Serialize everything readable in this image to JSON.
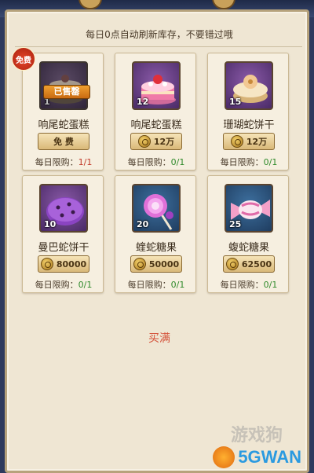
{
  "header": {
    "hint": "每日0点自动刷新库存，不要错过哦"
  },
  "items": [
    {
      "name": "响尾蛇蛋糕",
      "qty": "1",
      "price": "免 费",
      "coin": false,
      "limit_label": "每日限购：",
      "limit_value": "1/1",
      "limit_full": true,
      "sold_label": "已售罄",
      "free_badge": "免费",
      "art": "cake",
      "bg": "gray"
    },
    {
      "name": "响尾蛇蛋糕",
      "qty": "12",
      "price": "12万",
      "coin": true,
      "limit_label": "每日限购：",
      "limit_value": "0/1",
      "limit_full": false,
      "art": "cake",
      "bg": "purple"
    },
    {
      "name": "珊瑚蛇饼干",
      "qty": "15",
      "price": "12万",
      "coin": true,
      "limit_label": "每日限购：",
      "limit_value": "0/1",
      "limit_full": false,
      "art": "cookie",
      "bg": "purple"
    },
    {
      "name": "曼巴蛇饼干",
      "qty": "10",
      "price": "80000",
      "coin": true,
      "limit_label": "每日限购：",
      "limit_value": "0/1",
      "limit_full": false,
      "art": "purple-cookie",
      "bg": "purple"
    },
    {
      "name": "蝰蛇糖果",
      "qty": "20",
      "price": "50000",
      "coin": true,
      "limit_label": "每日限购：",
      "limit_value": "0/1",
      "limit_full": false,
      "art": "lollipop",
      "bg": "blue"
    },
    {
      "name": "蝮蛇糖果",
      "qty": "25",
      "price": "62500",
      "coin": true,
      "limit_label": "每日限购：",
      "limit_value": "0/1",
      "limit_full": false,
      "art": "candy",
      "bg": "blue"
    }
  ],
  "footer": {
    "buy_full": "买满"
  },
  "watermark": {
    "text": "5GWAN",
    "cn": "游戏狗"
  },
  "colors": {
    "panel": "#efe6d3",
    "limit_full": "#c23a2a",
    "limit_ok": "#2f8a2a",
    "buy_full": "#d4523a"
  }
}
